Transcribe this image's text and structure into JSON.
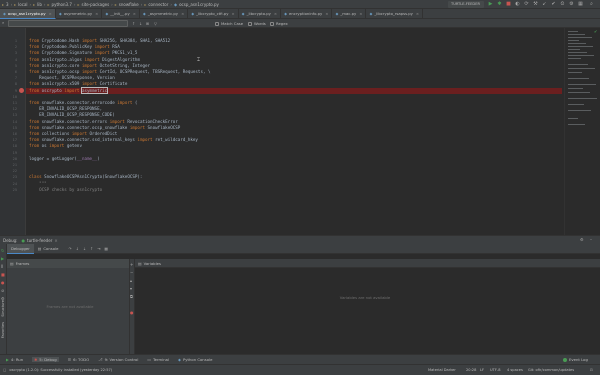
{
  "titlebar": {
    "breadcrumb": [
      "3",
      "local",
      "lib",
      "python3.7",
      "site-packages",
      "snowflake",
      "connector",
      "ocsp_asn1crypto.py"
    ],
    "run_config": "TURTLE-FEEDER"
  },
  "tabs": [
    {
      "label": "ocsp_asn1crypto.py",
      "active": true
    },
    {
      "label": "asymmetric.py",
      "active": false
    },
    {
      "label": "__init__.py",
      "active": false
    },
    {
      "label": "_asymmetric.py",
      "active": false
    },
    {
      "label": "_libcrypto_ctfi.py",
      "active": false
    },
    {
      "label": "_libcrypto.py",
      "active": false
    },
    {
      "label": "encryptioninfo.py",
      "active": false
    },
    {
      "label": "_mac.py",
      "active": false
    },
    {
      "label": "_libcrypto_rsapss.py",
      "active": false
    }
  ],
  "search": {
    "value": "",
    "options": [
      "Match Case",
      "Words",
      "Regex"
    ]
  },
  "code_lines": [
    {
      "n": "1",
      "html": "<span class='kw'>from</span> Cryptodome.Hash <span class='kw'>import</span> SHA256, SHA384, SHA1, SHA512"
    },
    {
      "n": "2",
      "html": "<span class='kw'>from</span> Cryptodome.PublicKey <span class='kw'>import</span> RSA"
    },
    {
      "n": "3",
      "html": "<span class='kw'>from</span> Cryptodome.Signature <span class='kw'>import</span> PKCS1_v1_5"
    },
    {
      "n": "4",
      "html": "<span class='kw'>from</span> asn1crypto.algos <span class='kw'>import</span> DigestAlgorithm"
    },
    {
      "n": "5",
      "html": "<span class='kw'>from</span> asn1crypto.core <span class='kw'>import</span> OctetString, Integer"
    },
    {
      "n": "6",
      "html": "<span class='kw'>from</span> asn1crypto.ocsp <span class='kw'>import</span> CertId, OCSPRequest, TBSRequest, Requests, \\"
    },
    {
      "n": "7",
      "html": "    Request, OCSPResponse, Version"
    },
    {
      "n": "8",
      "html": "<span class='kw'>from</span> asn1crypto.x509 <span class='kw'>import</span> Certificate"
    },
    {
      "n": "9",
      "html": "<span class='kw'>from</span> oscrypto <span class='kw'>import</span> asymmetric",
      "hl": true
    },
    {
      "n": "10",
      "html": ""
    },
    {
      "n": "11",
      "html": "<span class='kw'>from</span> snowflake.connector.errorcode <span class='kw'>import</span> ("
    },
    {
      "n": "12",
      "html": "    ER_INVALID_OCSP_RESPONSE,"
    },
    {
      "n": "13",
      "html": "    ER_INVALID_OCSP_RESPONSE_CODE)"
    },
    {
      "n": "14",
      "html": "<span class='kw'>from</span> snowflake.connector.errors <span class='kw'>import</span> RevocationCheckError"
    },
    {
      "n": "15",
      "html": "<span class='kw'>from</span> snowflake.connector.ocsp_snowflake <span class='kw'>import</span> SnowflakeOCSP"
    },
    {
      "n": "16",
      "html": "<span class='kw'>from</span> collections <span class='kw'>import</span> OrderedDict"
    },
    {
      "n": "17",
      "html": "<span class='kw'>from</span> snowflake.connector.ssd_internal_keys <span class='kw'>import</span> ret_wildcard_hkey"
    },
    {
      "n": "18",
      "html": "<span class='kw'>from</span> os <span class='kw'>import</span> getenv"
    },
    {
      "n": "19",
      "html": ""
    },
    {
      "n": "20",
      "html": "logger = getLogger(<span class='mag'>__name__</span>)"
    },
    {
      "n": "21",
      "html": ""
    },
    {
      "n": "22",
      "html": ""
    },
    {
      "n": "23",
      "html": "<span class='kw'>class</span> SnowflakeOCSPAsn1Crypto(SnowflakeOCSP):"
    },
    {
      "n": "24",
      "html": "    <span class='com'>\"\"\"</span>"
    },
    {
      "n": "25",
      "html": "    <span class='com'>OCSP checks by asn1crypto</span>"
    }
  ],
  "debug": {
    "label": "Debug:",
    "config": "turtle-feeder",
    "tabs": [
      "Debugger",
      "Console"
    ],
    "frames_label": "Frames",
    "frames_empty": "Frames are not available",
    "variables_label": "Variables",
    "variables_empty": "Variables are not available"
  },
  "bottom_tools": [
    "4: Run",
    "5: Debug",
    "6: TODO",
    "9: Version Control",
    "Terminal",
    "Python Console"
  ],
  "event_log": "Event Log",
  "status": {
    "message": "oscrypto (1.2.0): Successfully installed (yesterday 22:57)",
    "notification": "Material Darker",
    "position": "20:28",
    "line_ending": "LF",
    "encoding": "UTF-8",
    "indent": "4 spaces",
    "git": "Git: ofir/common/updates"
  },
  "colors": {
    "accent": "#4a88c7",
    "breakpoint": "#c75450",
    "highlight_line": "#6b1f1f",
    "run_green": "#499c54"
  }
}
